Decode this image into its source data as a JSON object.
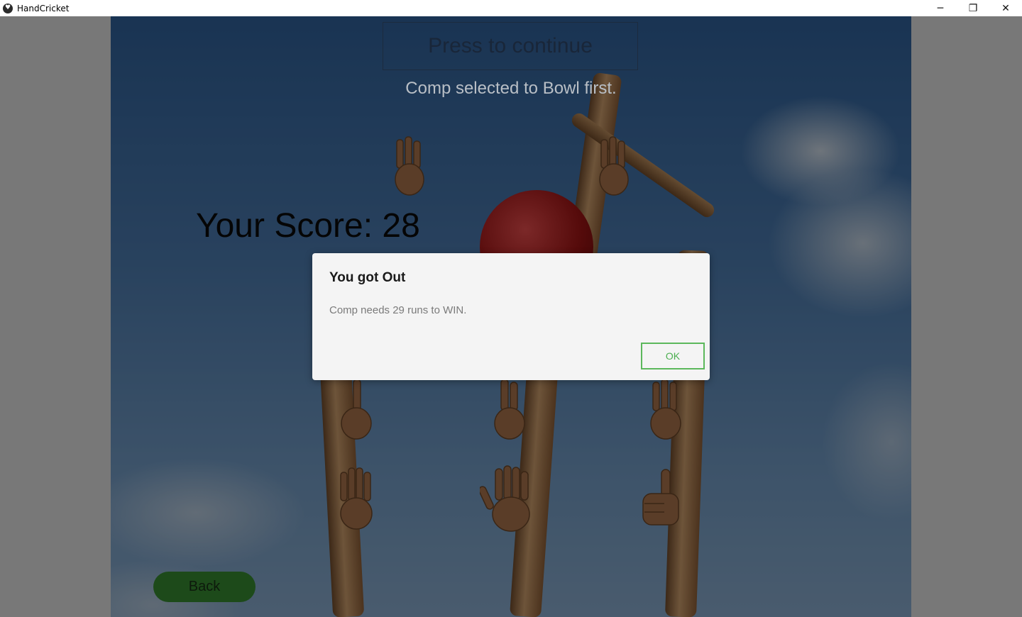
{
  "window": {
    "title": "HandCricket",
    "controls": {
      "minimize": "─",
      "restore": "❐",
      "close": "✕"
    }
  },
  "game": {
    "continue_label": "Press to continue",
    "status": "Comp selected to Bowl first.",
    "score": "Your Score: 28",
    "back_label": "Back",
    "hands": [
      {
        "name": "three-fingers-icon"
      },
      {
        "name": "three-fingers-icon"
      },
      {
        "name": "one-finger-icon"
      },
      {
        "name": "two-fingers-icon"
      },
      {
        "name": "three-fingers-icon"
      },
      {
        "name": "four-fingers-icon"
      },
      {
        "name": "five-fingers-icon"
      },
      {
        "name": "thumbs-up-icon"
      }
    ]
  },
  "dialog": {
    "title": "You got Out",
    "message": "Comp needs 29 runs to WIN.",
    "ok_label": "OK"
  },
  "colors": {
    "dialog_accent": "#5cb85c",
    "back_button": "#1d4a1a"
  }
}
